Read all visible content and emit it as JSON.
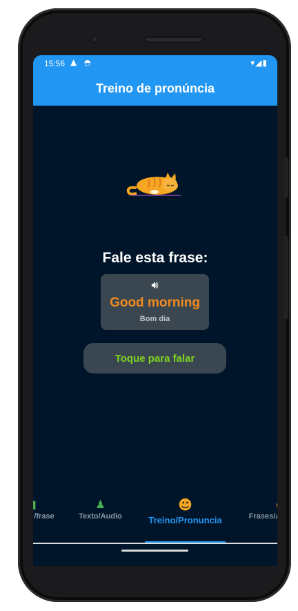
{
  "status_bar": {
    "time": "15:56",
    "warning_icon": "warning-icon",
    "sync_icon": "sync-icon",
    "right_icons": "wifi-icon signal-icon battery-icon"
  },
  "app_bar": {
    "title": "Treino de pronúncia"
  },
  "main": {
    "prompt": "Fale esta frase:",
    "card": {
      "audio_icon": "speaker-icon",
      "phrase": "Good morning",
      "translation": "Bom dia"
    },
    "speak_button": "Toque para falar"
  },
  "bottom_nav": {
    "items": [
      {
        "label": "/frase",
        "icon": "phrase-icon",
        "active": false
      },
      {
        "label": "Texto/Audio",
        "icon": "text-audio-icon",
        "active": false
      },
      {
        "label": "Treino/Pronuncia",
        "icon": "pronunciation-icon",
        "active": true
      },
      {
        "label": "Frases/A",
        "icon": "phrases-icon",
        "active": false
      }
    ]
  },
  "colors": {
    "primary": "#2196f3",
    "background": "#001529",
    "card": "#3a4750",
    "phrase": "#f28a1f",
    "speak": "#7ed321"
  }
}
